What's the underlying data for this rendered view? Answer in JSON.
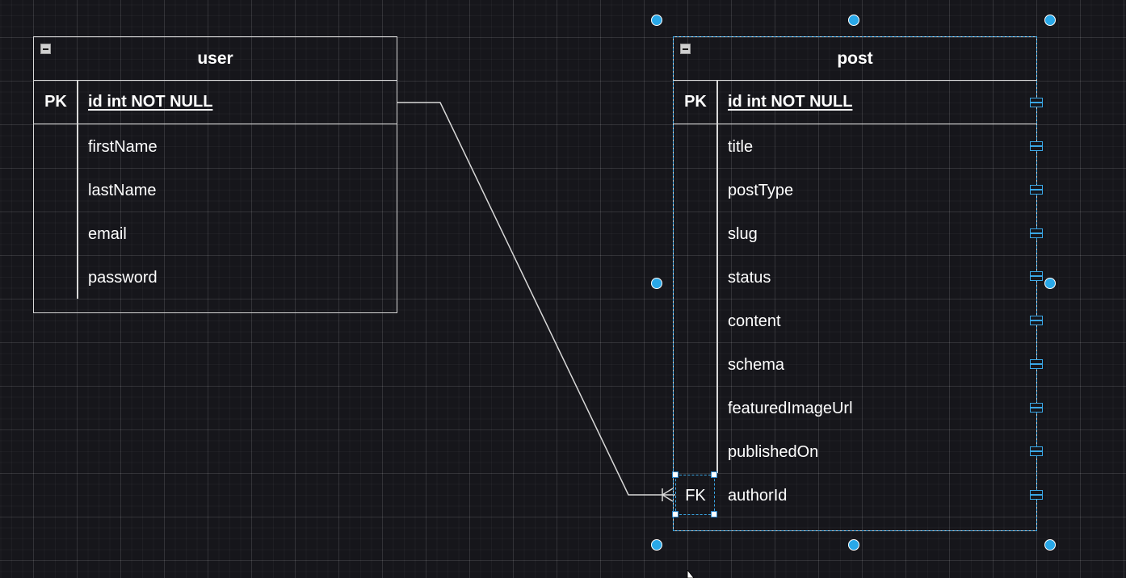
{
  "diagram": {
    "tables": {
      "user": {
        "name": "user",
        "pk_label": "PK",
        "pk_field": "id int NOT NULL",
        "fields": [
          "firstName",
          "lastName",
          "email",
          "password"
        ]
      },
      "post": {
        "name": "post",
        "pk_label": "PK",
        "pk_field": "id int NOT NULL",
        "fields": [
          "title",
          "postType",
          "slug",
          "status",
          "content",
          "schema",
          "featuredImageUrl",
          "publishedOn",
          "authorId"
        ],
        "fk_label": "FK"
      }
    },
    "relationship": {
      "from": "user.id",
      "to": "post.authorId",
      "cardinality": "one-to-many"
    },
    "colors": {
      "background": "#16161b",
      "stroke": "#d8d8d8",
      "selection": "#3aa7e6",
      "handle": "#29a8e8"
    }
  }
}
